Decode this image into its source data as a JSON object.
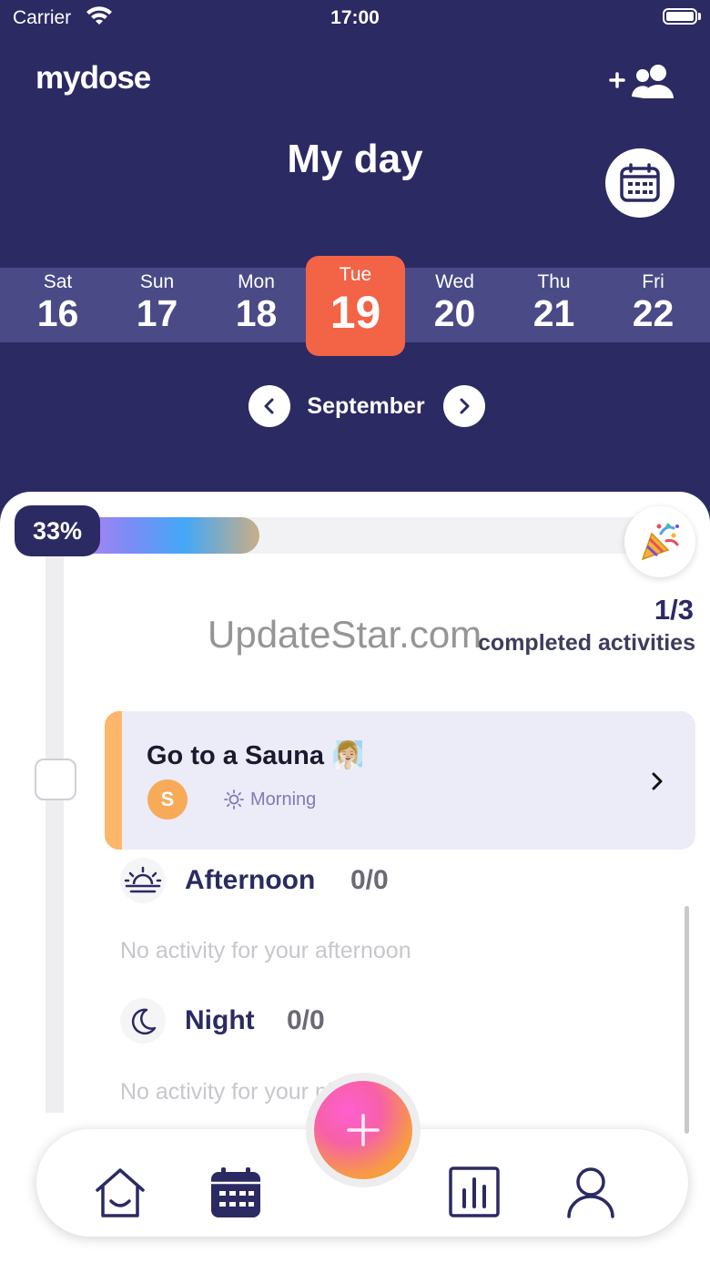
{
  "status_bar": {
    "carrier": "Carrier",
    "time": "17:00"
  },
  "header": {
    "logo": "mydose",
    "title": "My day"
  },
  "week": [
    {
      "name": "Sat",
      "num": "16",
      "selected": false
    },
    {
      "name": "Sun",
      "num": "17",
      "selected": false
    },
    {
      "name": "Mon",
      "num": "18",
      "selected": false
    },
    {
      "name": "Tue",
      "num": "19",
      "selected": true
    },
    {
      "name": "Wed",
      "num": "20",
      "selected": false
    },
    {
      "name": "Thu",
      "num": "21",
      "selected": false
    },
    {
      "name": "Fri",
      "num": "22",
      "selected": false
    }
  ],
  "month": {
    "label": "September"
  },
  "progress": {
    "percent_label": "33%",
    "fraction": 0.33,
    "count": "1/3",
    "label": "completed activities"
  },
  "watermark": "UpdateStar.com",
  "activity": {
    "title": "Go to a Sauna 🧖🏼‍♀️",
    "avatar_letter": "S",
    "period": "Morning"
  },
  "sections": {
    "afternoon": {
      "title": "Afternoon",
      "count": "0/0",
      "empty": "No activity for your afternoon"
    },
    "night": {
      "title": "Night",
      "count": "0/0",
      "empty": "No activity for your night"
    }
  },
  "colors": {
    "primary": "#2B2A63",
    "accent": "#F36346",
    "card": "#ECEBF8",
    "card_bar": "#FDB66A"
  },
  "icons": [
    "wifi-icon",
    "battery-icon",
    "add-user-icon",
    "calendar-icon",
    "chevron-left-icon",
    "chevron-right-icon",
    "party-popper-icon",
    "sun-icon",
    "sunset-icon",
    "moon-icon",
    "home-icon",
    "calendar-tab-icon",
    "plus-icon",
    "stats-icon",
    "profile-icon"
  ]
}
